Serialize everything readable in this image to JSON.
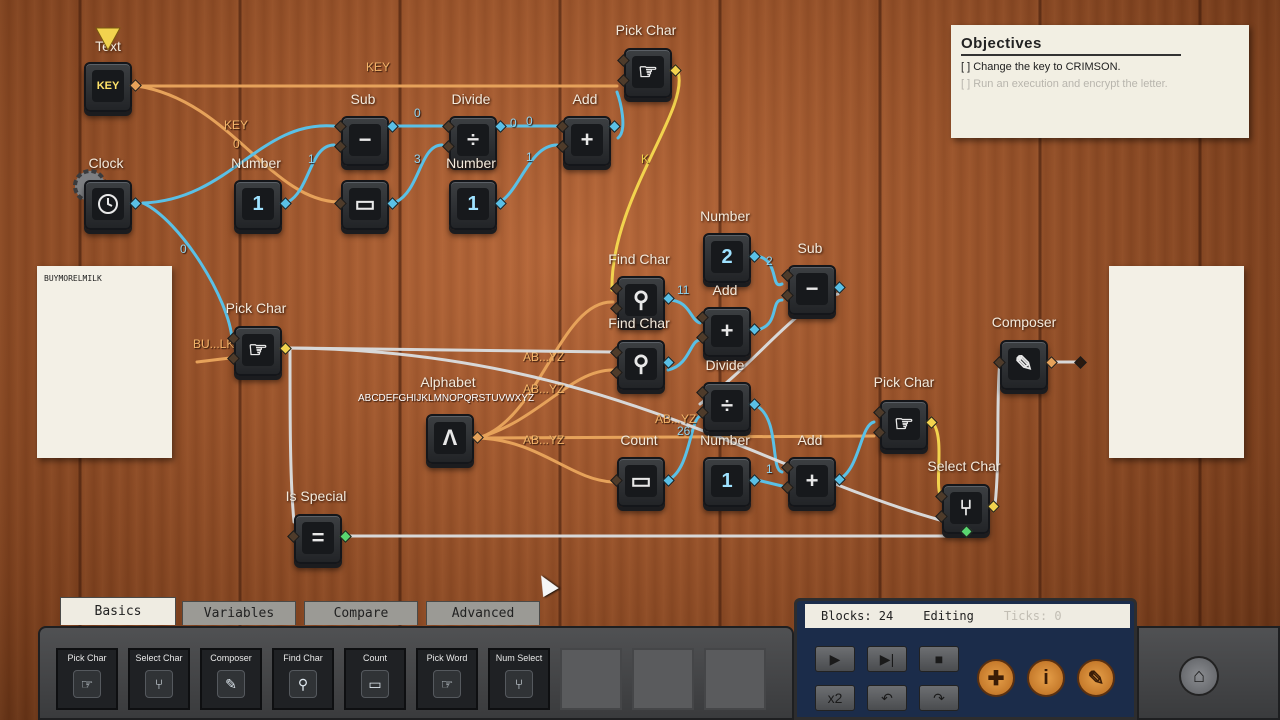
{
  "nodes": {
    "text": {
      "label": "Text",
      "value": "KEY"
    },
    "clock": {
      "label": "Clock",
      "icon": "clock-icon"
    },
    "number1": {
      "label": "Number",
      "value": "1"
    },
    "count1": {
      "label": "Count",
      "icon": "ruler-icon"
    },
    "sub1": {
      "label": "Sub",
      "symbol": "−"
    },
    "divide1": {
      "label": "Divide",
      "symbol": "÷"
    },
    "number2": {
      "label": "Number",
      "value": "1"
    },
    "add1": {
      "label": "Add",
      "symbol": "+"
    },
    "pick_char_top": {
      "label": "Pick Char",
      "icon": "hand-icon"
    },
    "pick_char_left": {
      "label": "Pick Char",
      "icon": "hand-icon"
    },
    "number3": {
      "label": "Number",
      "value": "2"
    },
    "sub2": {
      "label": "Sub",
      "symbol": "−"
    },
    "find_char1": {
      "label": "Find Char",
      "icon": "magnifier-icon"
    },
    "add2": {
      "label": "Add",
      "symbol": "+"
    },
    "find_char2": {
      "label": "Find Char",
      "icon": "magnifier-icon"
    },
    "divide2": {
      "label": "Divide",
      "symbol": "÷"
    },
    "alphabet": {
      "label": "Alphabet",
      "symbol": "Λ",
      "value": "ABCDEFGHIJKLMNOPQRSTUVWXYZ"
    },
    "count2": {
      "label": "Count",
      "icon": "ruler-icon"
    },
    "number4": {
      "label": "Number",
      "value": "1"
    },
    "add3": {
      "label": "Add",
      "symbol": "+"
    },
    "pick_char_right": {
      "label": "Pick Char",
      "icon": "hand-icon"
    },
    "select_char": {
      "label": "Select Char",
      "icon": "fork-icon"
    },
    "composer": {
      "label": "Composer",
      "icon": "feather-icon"
    },
    "is_special": {
      "label": "Is Special",
      "symbol": "="
    }
  },
  "wire_labels": {
    "key_top": "KEY",
    "key_mid": "KEY",
    "k": "K",
    "zero_a": "0",
    "zero_b": "0",
    "zero_c": "0",
    "zero_d": "0",
    "zero_e": "0",
    "one_a": "1",
    "one_b": "1",
    "one_c": "1",
    "three": "3",
    "eleven": "11",
    "two": "2",
    "twenty_six": "26",
    "bu_lk": "BU...LK",
    "ab_yz_1": "AB...YZ",
    "ab_yz_2": "AB...YZ",
    "ab_yz_3": "AB...YZ",
    "ab_yz_4": "AB...YZ"
  },
  "input_paper": {
    "text": "BUYMORELMILK"
  },
  "objectives": {
    "title": "Objectives",
    "items": [
      {
        "text": "[ ] Change the key to CRIMSON.",
        "active": true
      },
      {
        "text": "[ ] Run an execution and encrypt the letter.",
        "active": false
      }
    ]
  },
  "tabs": [
    "Basics",
    "Variables",
    "Compare",
    "Advanced"
  ],
  "toolbox": [
    {
      "label": "Pick Char",
      "icon": "hand-icon"
    },
    {
      "label": "Select Char",
      "icon": "fork-icon"
    },
    {
      "label": "Composer",
      "icon": "feather-icon"
    },
    {
      "label": "Find Char",
      "icon": "magnifier-icon"
    },
    {
      "label": "Count",
      "icon": "ruler-icon"
    },
    {
      "label": "Pick Word",
      "icon": "hand-icon"
    },
    {
      "label": "Num Select",
      "icon": "fork-icon"
    }
  ],
  "status": {
    "blocks": "Blocks: 24",
    "mode": "Editing",
    "ticks": "Ticks: 0"
  },
  "controls": {
    "speed": "x2"
  },
  "colors": {
    "wire_orange": "#e6a25a",
    "wire_blue": "#5ac0e6",
    "wire_yellow": "#f2d34e",
    "wire_white": "#d8d8d8",
    "wood": "#9a532a"
  }
}
